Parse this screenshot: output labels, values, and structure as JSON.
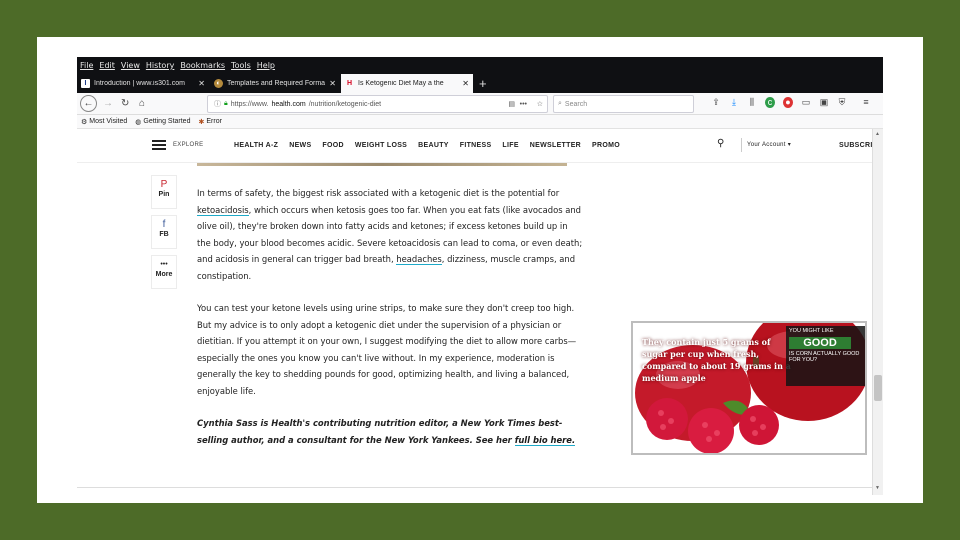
{
  "menubar": [
    "File",
    "Edit",
    "View",
    "History",
    "Bookmarks",
    "Tools",
    "Help"
  ],
  "tabs": [
    {
      "label": "Introduction | www.is301.com",
      "favicon": "I",
      "active": false
    },
    {
      "label": "Templates and Required Forma",
      "favicon": "◐",
      "active": false
    },
    {
      "label": "Is Ketogenic Diet May a the",
      "favicon": "H",
      "active": true
    }
  ],
  "newtab_symbol": "+",
  "url": {
    "prefix": "https://www.",
    "host": "health.com",
    "path": "/nutrition/ketogenic-diet"
  },
  "search_placeholder": "Search",
  "bookmarks": [
    "Most Visited",
    "Getting Started",
    "Error"
  ],
  "site": {
    "explore": "EXPLORE",
    "nav": [
      "HEALTH A-Z",
      "NEWS",
      "FOOD",
      "WEIGHT LOSS",
      "BEAUTY",
      "FITNESS",
      "LIFE",
      "NEWSLETTER",
      "PROMO"
    ],
    "account": "Your Account ▾",
    "subscribe": "SUBSCRI"
  },
  "share": [
    {
      "icon": "pinterest-icon",
      "sym": "P",
      "label": "Pin"
    },
    {
      "icon": "facebook-icon",
      "sym": "f",
      "label": "FB"
    },
    {
      "icon": "more-icon",
      "sym": "•••",
      "label": "More"
    }
  ],
  "article": {
    "p1_a": "In terms of safety, the biggest risk associated with a ketogenic diet is the potential for ",
    "p1_link1": "ketoacidosis",
    "p1_b": ", which occurs when ketosis goes too far. When you eat fats (like avocados and olive oil), they're broken down into fatty acids and ketones; if excess ketones build up in the body, your blood becomes acidic. Severe ketoacidosis can lead to coma, or even death; and acidosis in general can trigger bad breath, ",
    "p1_link2": "headaches",
    "p1_c": ", dizziness, muscle cramps, and constipation.",
    "p2": "You can test your ketone levels using urine strips, to make sure they don't creep too high. But my advice is to only adopt a ketogenic diet under the supervision of a physician or dietitian. If you attempt it on your own, I suggest modifying the diet to allow more carbs—especially the ones you know you can't live without. In my experience, moderation is generally the key to shedding pounds for good, optimizing health, and living a balanced, enjoyable life.",
    "bio": "Cynthia Sass is Health's contributing nutrition editor, a New York Times best-selling author, and a consultant for the New York Yankees. See her ",
    "bio_link": "full bio here."
  },
  "ad": {
    "text": "They contain just 5 grams of sugar per cup when fresh, compared to about 19 grams in a medium apple",
    "side_top": "YOU MIGHT LIKE",
    "side_good": "GOOD",
    "side_bottom": "IS CORN ACTUALLY GOOD FOR YOU?"
  }
}
